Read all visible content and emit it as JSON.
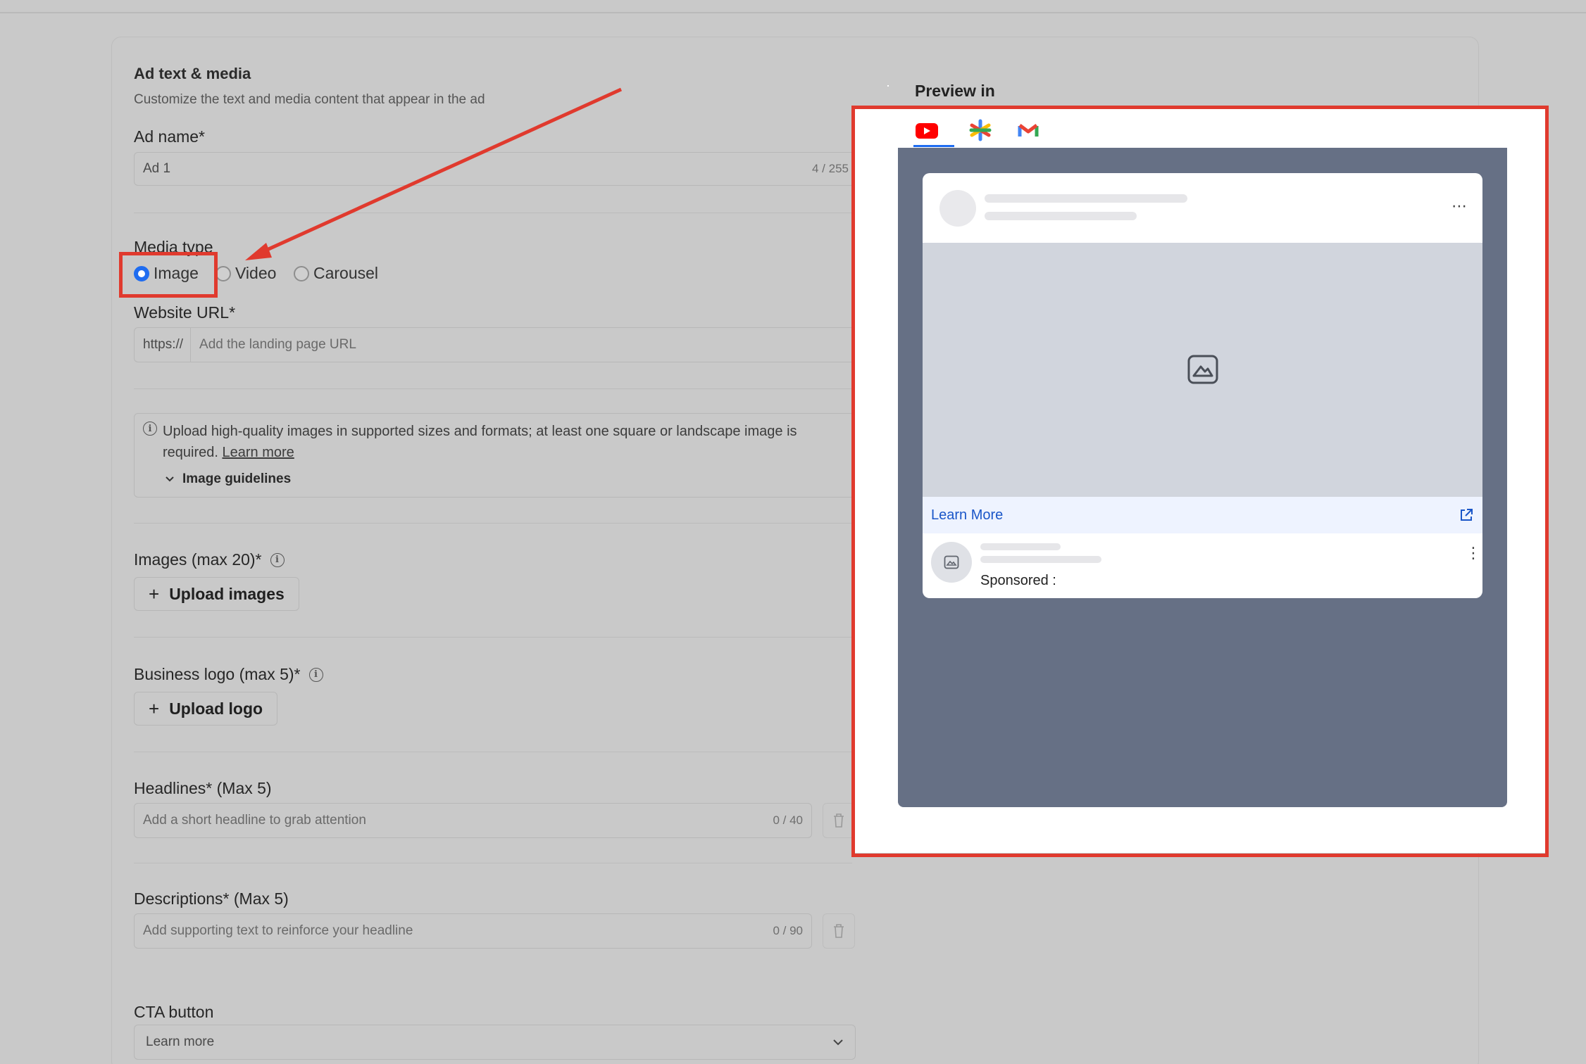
{
  "form": {
    "section_title": "Ad text & media",
    "section_subtitle": "Customize the text and media content that appear in the ad",
    "ad_name": {
      "label": "Ad name*",
      "value": "Ad 1",
      "counter": "4 / 255"
    },
    "media_type": {
      "label": "Media type",
      "options": [
        "Image",
        "Video",
        "Carousel"
      ],
      "selected": "Image"
    },
    "website_url": {
      "label": "Website URL*",
      "prefix": "https://",
      "placeholder": "Add the landing page URL"
    },
    "info": {
      "text": "Upload high-quality images in supported sizes and formats; at least one square or landscape image is required.",
      "link": "Learn more",
      "toggle": "Image guidelines"
    },
    "images": {
      "label": "Images (max 20)*",
      "button": "Upload images"
    },
    "logo": {
      "label": "Business logo (max 5)*",
      "button": "Upload logo"
    },
    "headlines": {
      "label": "Headlines* (Max 5)",
      "placeholder": "Add a short headline to grab attention",
      "counter": "0 / 40"
    },
    "descriptions": {
      "label": "Descriptions* (Max 5)",
      "placeholder": "Add supporting text to reinforce your headline",
      "counter": "0 / 90"
    },
    "cta": {
      "label": "CTA button",
      "value": "Learn more"
    }
  },
  "preview": {
    "title": "Preview in",
    "tabs": [
      "youtube-icon",
      "discover-icon",
      "gmail-icon"
    ],
    "active_tab": "youtube-icon",
    "card": {
      "cta_label": "Learn More",
      "sponsored": "Sponsored :"
    }
  },
  "colors": {
    "highlight": "#e03a2e",
    "accent": "#1f6cf0",
    "stage": "#667085"
  }
}
